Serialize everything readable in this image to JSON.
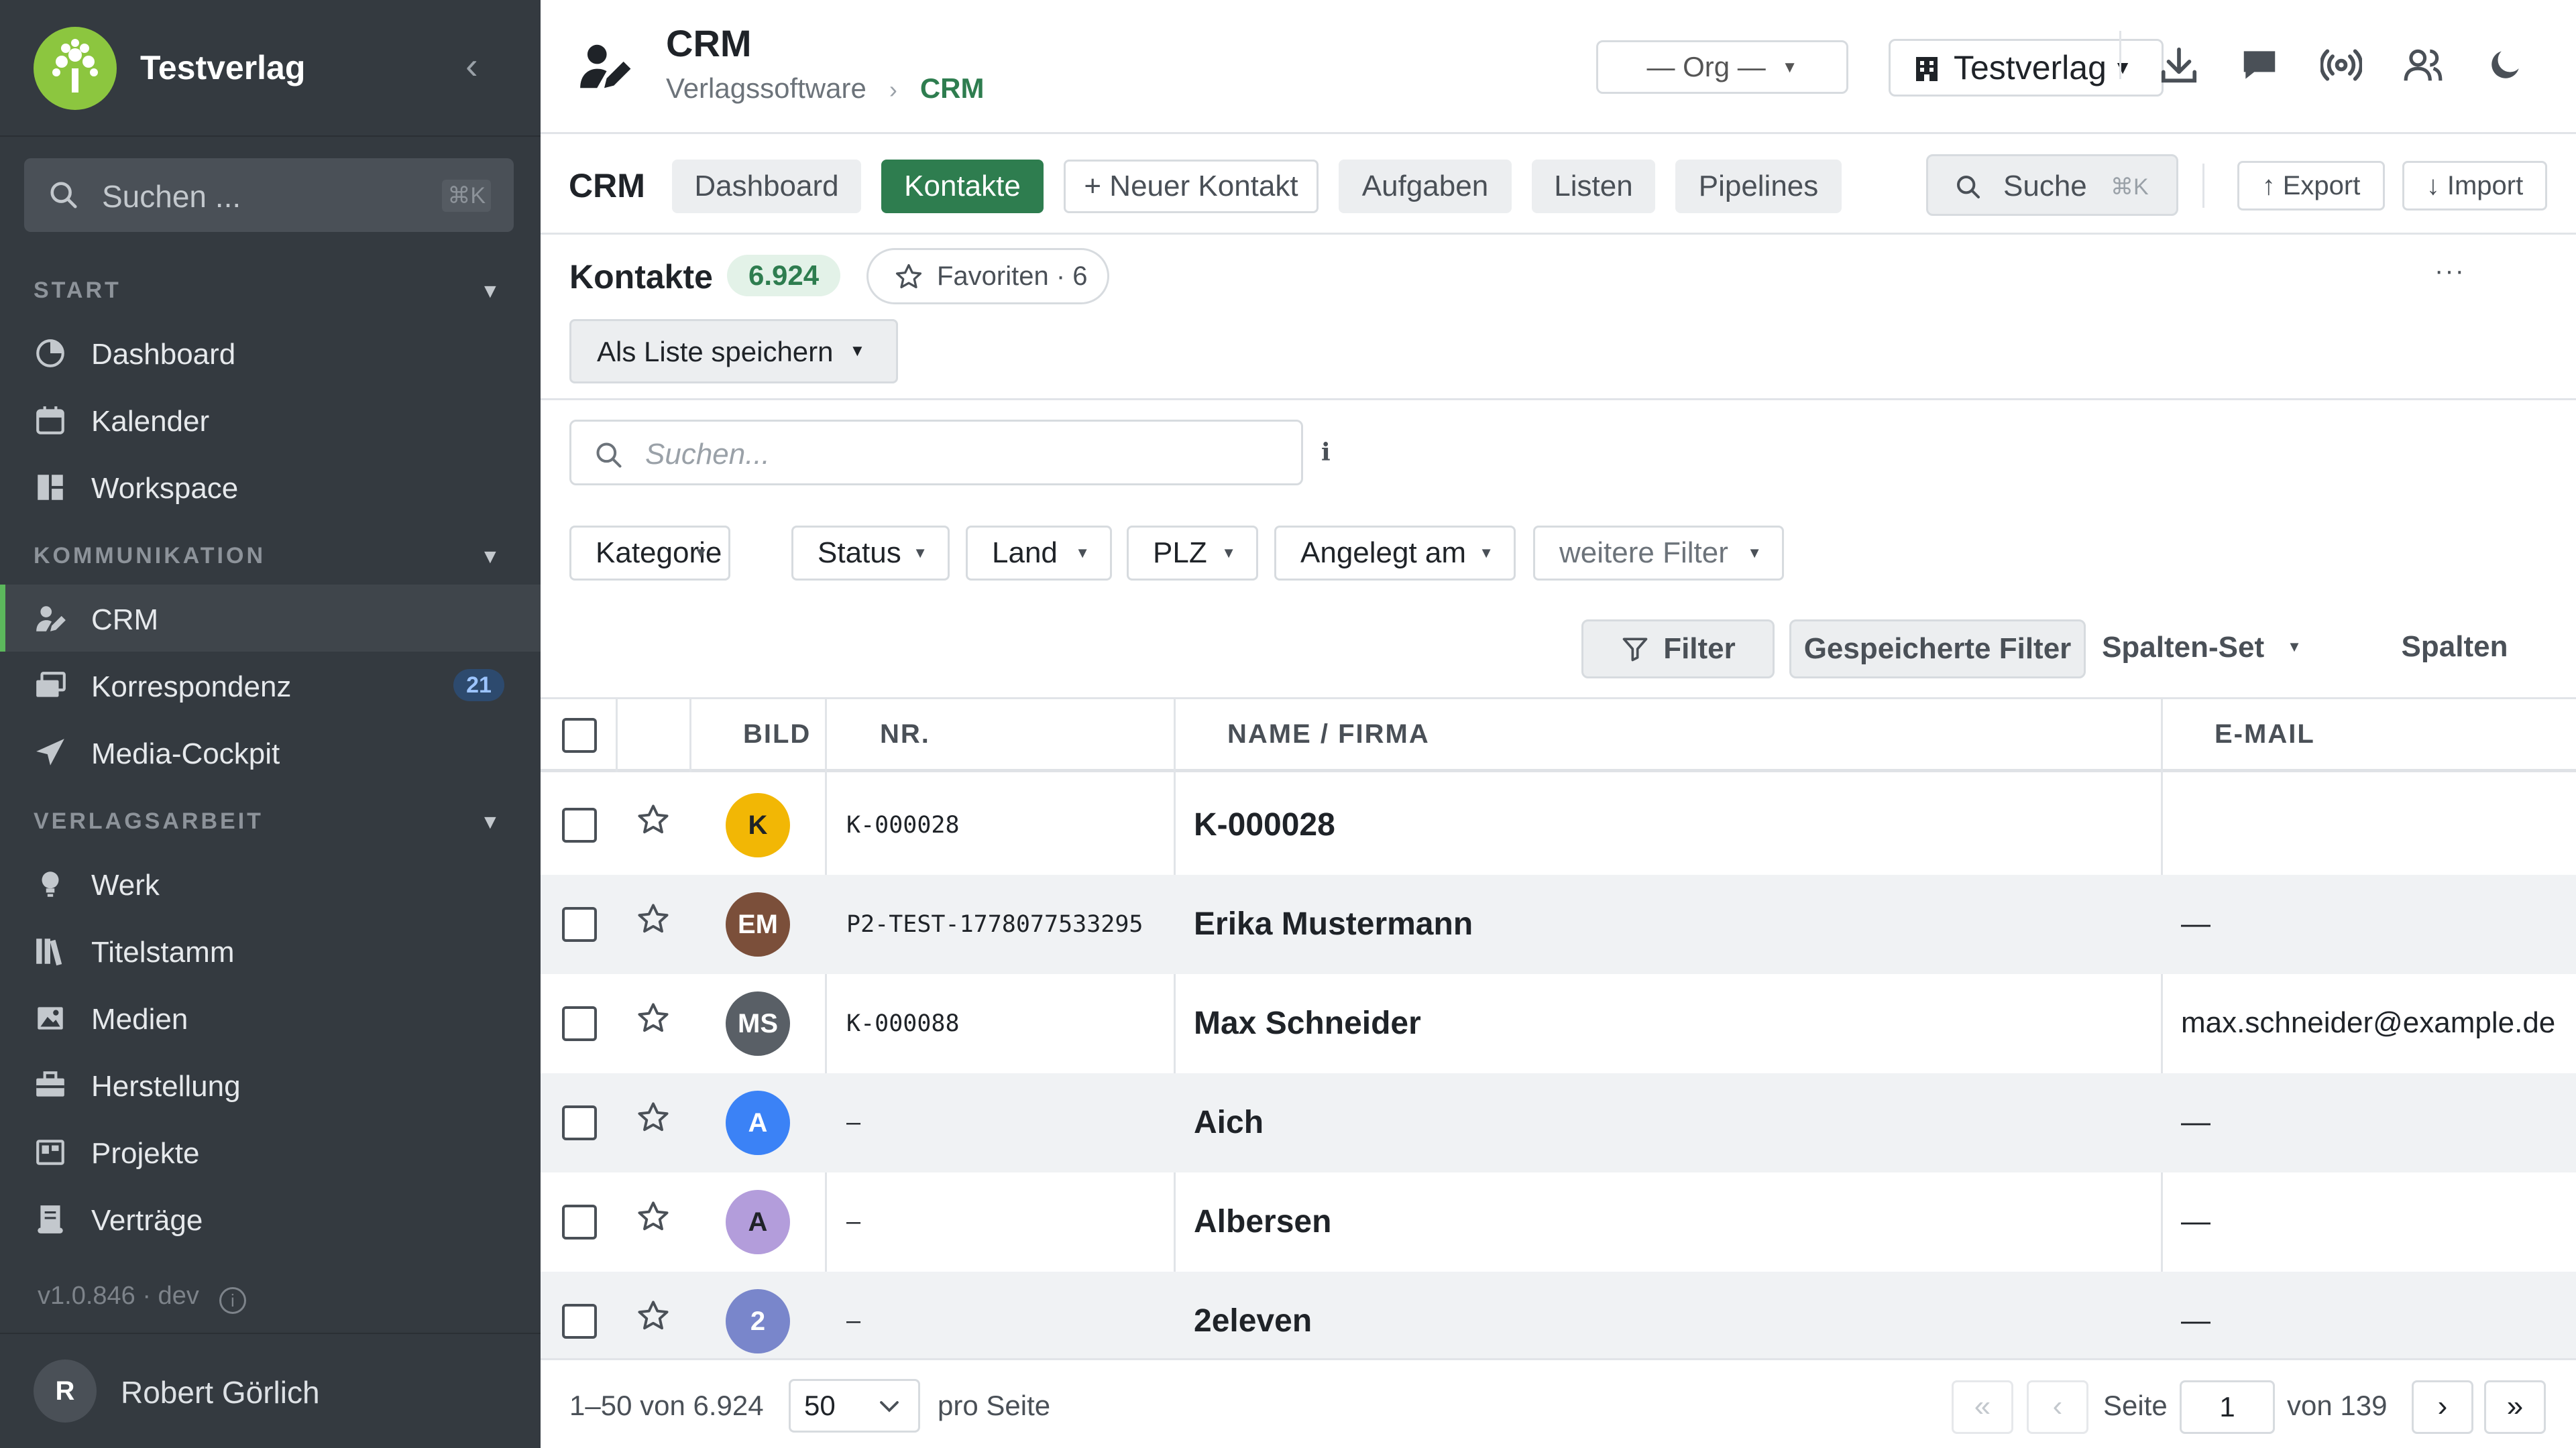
{
  "sidebar": {
    "brand": "Testverlag",
    "search_placeholder": "Suchen ...",
    "search_shortcut": "⌘K",
    "sections": {
      "start": "START",
      "kommunikation": "KOMMUNIKATION",
      "verlagsarbeit": "VERLAGSARBEIT"
    },
    "items": {
      "dashboard": "Dashboard",
      "kalender": "Kalender",
      "workspace": "Workspace",
      "crm": "CRM",
      "korrespondenz": "Korrespondenz",
      "korrespondenz_badge": "21",
      "media_cockpit": "Media-Cockpit",
      "werk": "Werk",
      "titelstamm": "Titelstamm",
      "medien": "Medien",
      "herstellung": "Herstellung",
      "projekte": "Projekte",
      "vertraege": "Verträge"
    },
    "version": "v1.0.846 · dev",
    "user": {
      "initial": "R",
      "name": "Robert Görlich"
    }
  },
  "header": {
    "title": "CRM",
    "breadcrumb_root": "Verlagssoftware",
    "breadcrumb_sep": "›",
    "breadcrumb_current": "CRM",
    "org_select": "— Org —",
    "tenant_select": "Testverlag"
  },
  "toolbar": {
    "title": "CRM",
    "tabs": {
      "dashboard": "Dashboard",
      "kontakte": "Kontakte",
      "neuer_kontakt": "+ Neuer Kontakt",
      "aufgaben": "Aufgaben",
      "listen": "Listen",
      "pipelines": "Pipelines"
    },
    "search_label": "Suche",
    "search_shortcut": "⌘K",
    "export": "↑ Export",
    "import": "↓ Import"
  },
  "list": {
    "title": "Kontakte",
    "count": "6.924",
    "favorites": "Favoriten · 6",
    "more": "···",
    "save_list": "Als Liste speichern"
  },
  "filters": {
    "search_placeholder": "Suchen...",
    "info": "i",
    "chips": {
      "kategorie": "Kategorie",
      "status": "Status",
      "land": "Land",
      "plz": "PLZ",
      "angelegt_am": "Angelegt am",
      "weitere": "weitere Filter"
    },
    "filter_btn": "Filter",
    "saved_filters": "Gespeicherte Filter",
    "column_set": "Spalten-Set",
    "columns": "Spalten"
  },
  "table": {
    "headers": {
      "bild": "BILD",
      "nr": "NR.",
      "name": "NAME / FIRMA",
      "email": "E-MAIL"
    },
    "rows": [
      {
        "initials": "K",
        "color": "#f2b705",
        "text_color": "#1f2328",
        "nr": "K-000028",
        "name": "K-000028",
        "email": ""
      },
      {
        "initials": "EM",
        "color": "#7b4f3a",
        "text_color": "#ffffff",
        "nr": "P2-TEST-1778077533295",
        "name": "Erika Mustermann",
        "email": "—"
      },
      {
        "initials": "MS",
        "color": "#595f66",
        "text_color": "#ffffff",
        "nr": "K-000088",
        "name": "Max Schneider",
        "email": "max.schneider@example.de"
      },
      {
        "initials": "A",
        "color": "#3b82f6",
        "text_color": "#ffffff",
        "nr": "–",
        "name": "Aich",
        "email": "—"
      },
      {
        "initials": "A",
        "color": "#b39ddb",
        "text_color": "#1f2328",
        "nr": "–",
        "name": "Albersen",
        "email": "—"
      },
      {
        "initials": "2",
        "color": "#7986cb",
        "text_color": "#ffffff",
        "nr": "–",
        "name": "2eleven",
        "email": "—"
      }
    ]
  },
  "footer": {
    "range": "1–50 von 6.924",
    "per_page_value": "50",
    "per_page_label": "pro Seite",
    "first": "«",
    "prev": "‹",
    "page_label": "Seite",
    "page_value": "1",
    "of_pages": "von 139",
    "next": "›",
    "last": "»"
  },
  "colors": {
    "accent": "#2e7d4f",
    "sidebar_bg": "#343a40",
    "brand_green": "#8cc63f"
  }
}
